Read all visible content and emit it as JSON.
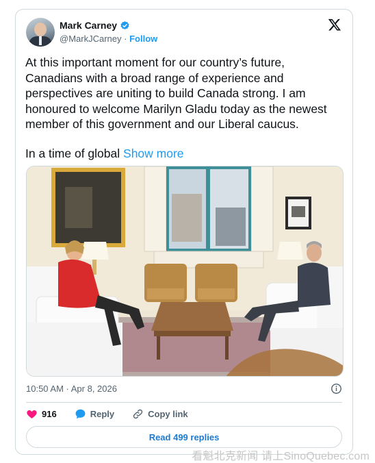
{
  "author": {
    "name": "Mark Carney",
    "handle": "@MarkJCarney",
    "separator": "·",
    "follow_label": "Follow",
    "avatar_icon": "profile-photo",
    "verified_icon": "verified-badge-icon"
  },
  "tweet": {
    "paragraph1": "At this important moment for our country’s future, Canadians with a broad range of experience and perspectives are uniting to build Canada strong. I am honoured to welcome Marilyn Gladu today as the newest member of this government and our Liberal caucus.",
    "paragraph2": "In a time of global",
    "show_more": "Show more"
  },
  "meta": {
    "timestamp": "10:50 AM · Apr 8, 2026"
  },
  "actions": {
    "likes": "916",
    "reply_label": "Reply",
    "copy_link_label": "Copy link"
  },
  "read_replies_label": "Read 499 replies",
  "watermark": "看魁北克新闻 请上SinoQuebec.com",
  "colors": {
    "accent": "#1d9bf0",
    "like": "#f91880",
    "muted": "#536471"
  }
}
